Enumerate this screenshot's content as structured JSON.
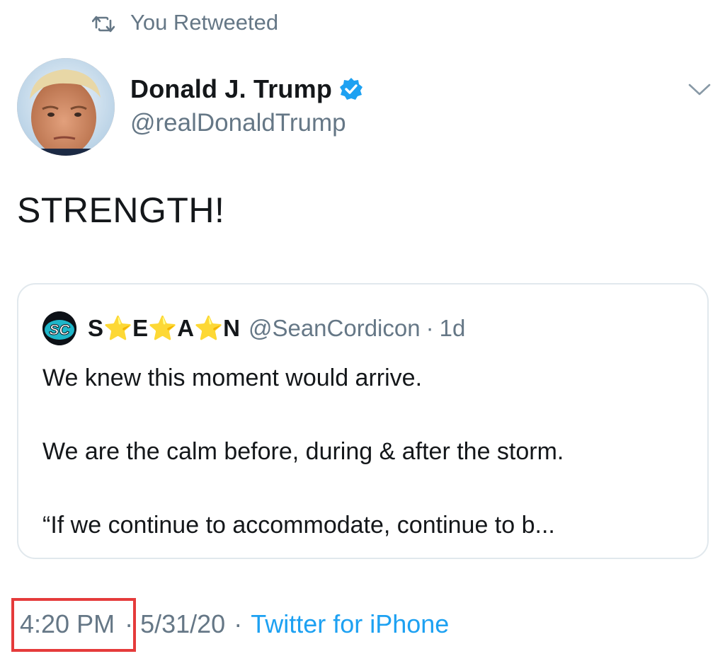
{
  "retweet_context": {
    "icon": "retweet-icon",
    "label": "You Retweeted"
  },
  "author": {
    "name": "Donald J. Trump",
    "handle": "@realDonaldTrump",
    "verified_icon": "verified-badge-icon",
    "verified_color": "#1da1f2"
  },
  "menu_icon": "chevron-down-icon",
  "tweet": {
    "text": "STRENGTH!"
  },
  "quoted_tweet": {
    "name": "S⭐E⭐A⭐N",
    "handle": "@SeanCordicon",
    "separator": "·",
    "age": "1d",
    "avatar_text": "SC",
    "lines": [
      "We knew this moment would arrive.",
      "We are the calm before, during & after the storm.",
      "“If we continue to accommodate, continue to b..."
    ]
  },
  "meta": {
    "time": "4:20 PM",
    "separator": "·",
    "date": "5/31/20",
    "source": "Twitter for iPhone"
  },
  "colors": {
    "text": "#14171a",
    "secondary": "#657786",
    "link": "#1da1f2",
    "highlight_box": "#e53b3b",
    "border": "#e1e8ed"
  }
}
